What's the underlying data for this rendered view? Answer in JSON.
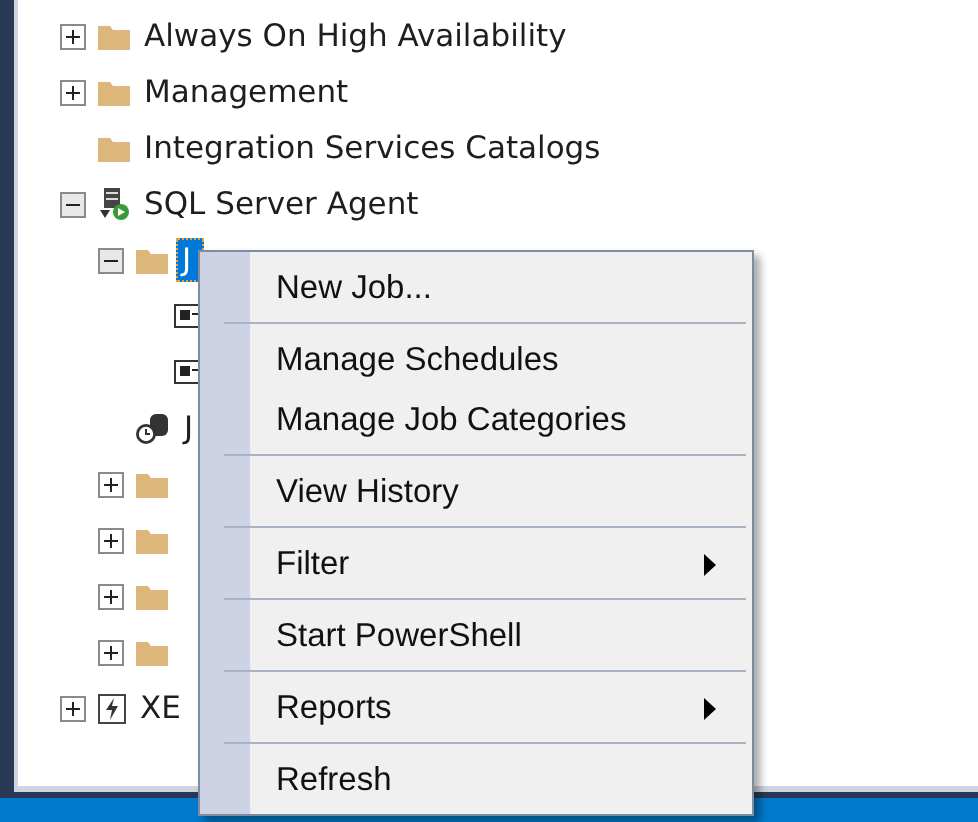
{
  "tree": [
    {
      "label": "Always On High Availability",
      "kind": "folder",
      "expanded": false,
      "selected": false
    },
    {
      "label": "Management",
      "kind": "folder",
      "expanded": false,
      "selected": false
    },
    {
      "label": "Integration Services Catalogs",
      "kind": "folder",
      "selected": false
    },
    {
      "label": "SQL Server Agent",
      "kind": "agent",
      "expanded": true,
      "selected": false,
      "children": [
        {
          "label": "J",
          "kind": "folder",
          "expanded": true,
          "selected": true,
          "children": [
            {
              "kind": "job",
              "selected": false
            },
            {
              "kind": "job",
              "selected": false
            }
          ]
        },
        {
          "label": "J",
          "kind": "monitor",
          "selected": false
        },
        {
          "kind": "folder",
          "expanded": false,
          "selected": false
        },
        {
          "kind": "folder",
          "expanded": false,
          "selected": false
        },
        {
          "kind": "folder",
          "expanded": false,
          "selected": false
        },
        {
          "kind": "folder",
          "expanded": false,
          "selected": false
        }
      ]
    },
    {
      "label": "XE",
      "kind": "xevent",
      "expanded": false,
      "selected": false
    }
  ],
  "context_menu": {
    "groups": [
      [
        {
          "label": "New Job...",
          "submenu": false
        }
      ],
      [
        {
          "label": "Manage Schedules",
          "submenu": false
        },
        {
          "label": "Manage Job Categories",
          "submenu": false
        }
      ],
      [
        {
          "label": "View History",
          "submenu": false
        }
      ],
      [
        {
          "label": "Filter",
          "submenu": true
        }
      ],
      [
        {
          "label": "Start PowerShell",
          "submenu": false
        }
      ],
      [
        {
          "label": "Reports",
          "submenu": true
        }
      ],
      [
        {
          "label": "Refresh",
          "submenu": false
        }
      ]
    ]
  }
}
